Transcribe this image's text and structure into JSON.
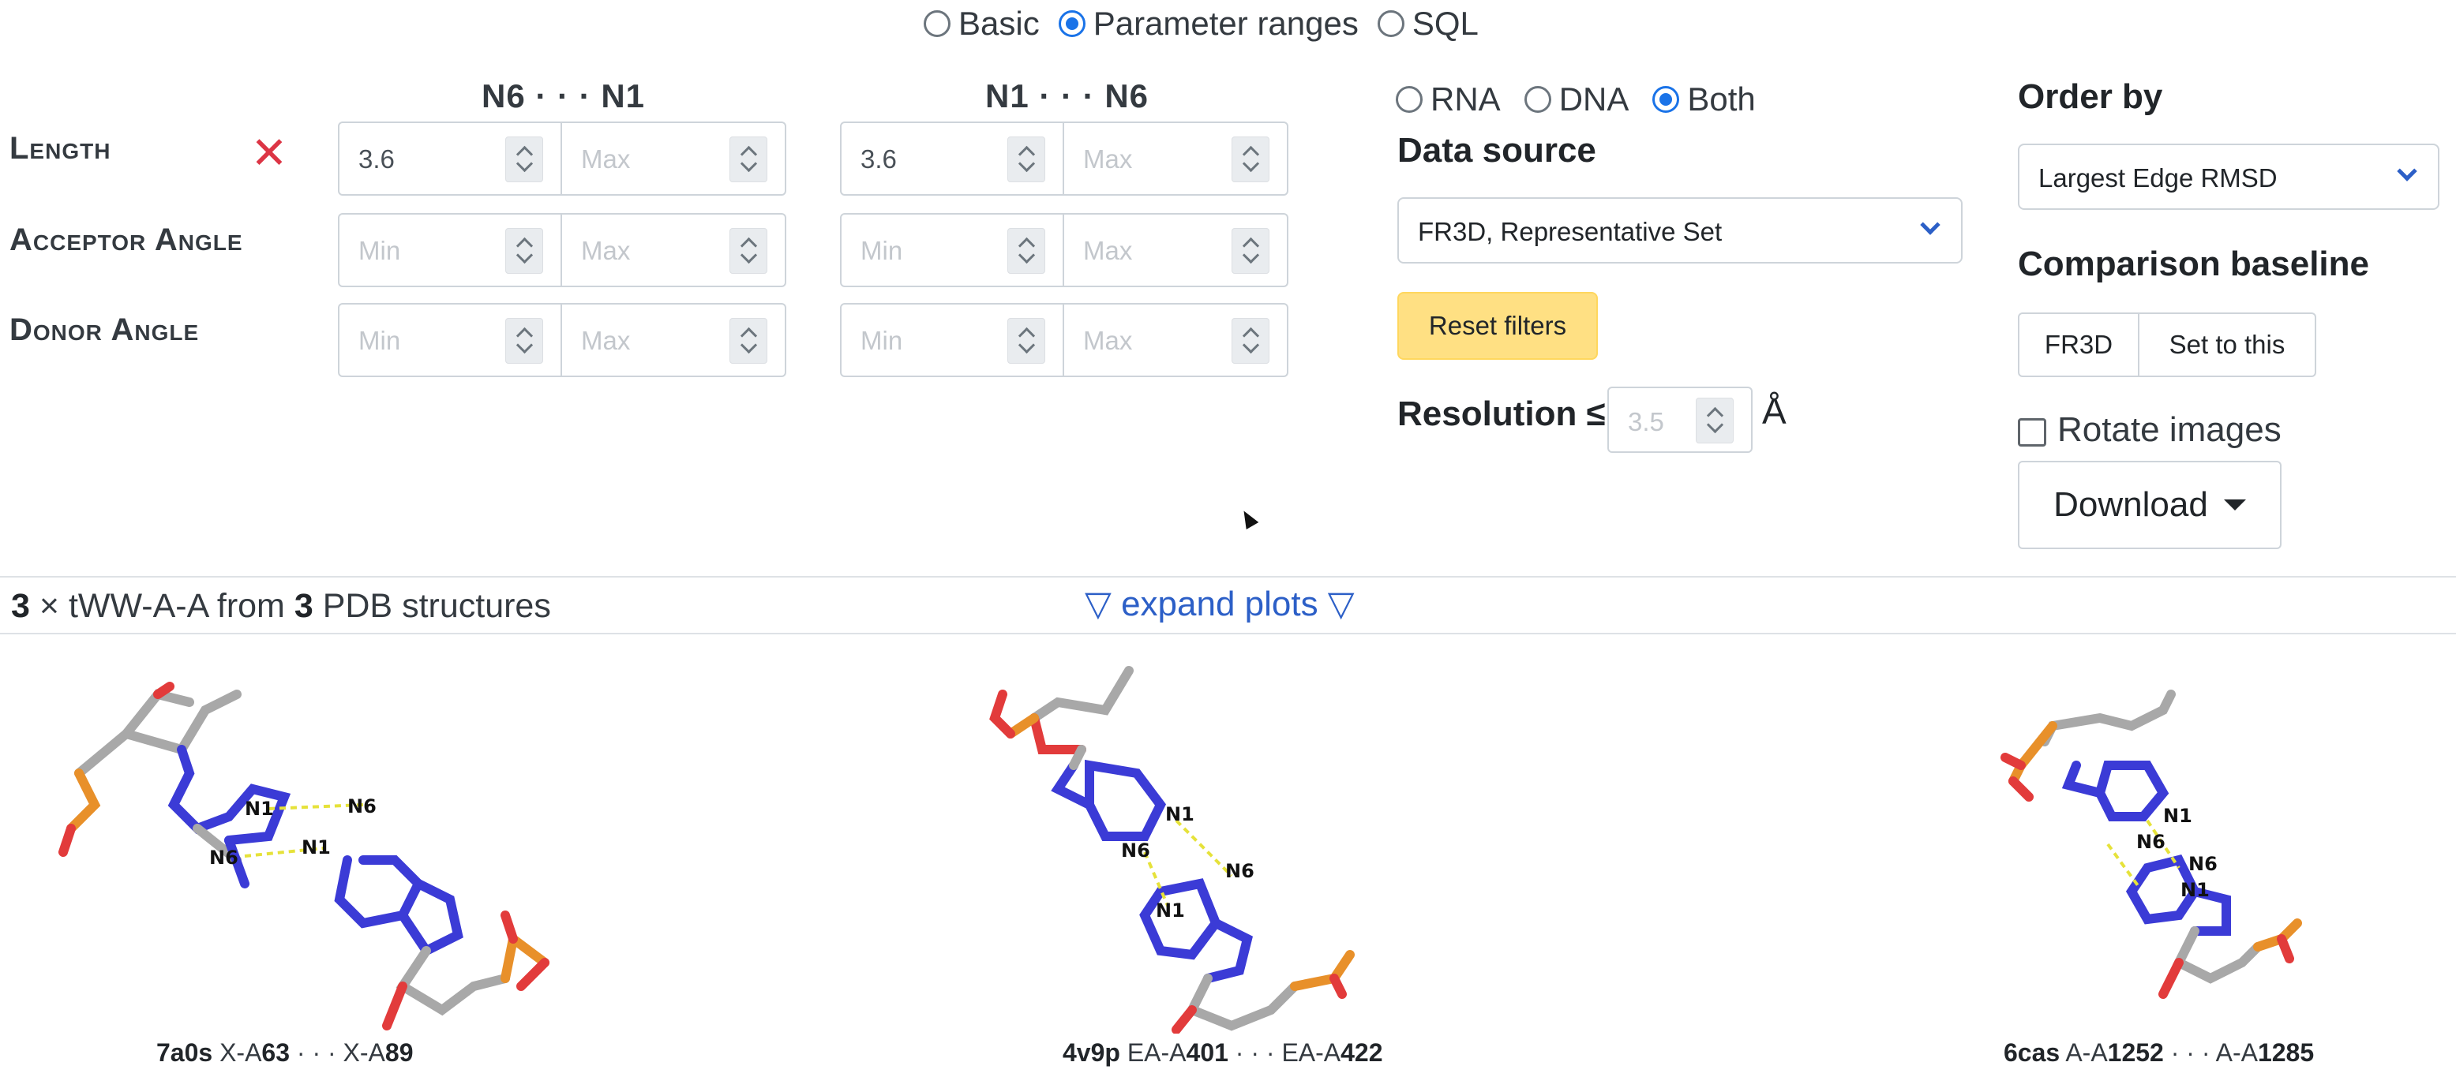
{
  "mode": {
    "options": [
      "Basic",
      "Parameter ranges",
      "SQL"
    ],
    "selected": "Parameter ranges"
  },
  "params": {
    "col1_header": "N6 · · · N1",
    "col2_header": "N1 · · · N6",
    "rows": [
      {
        "label": "Length",
        "col1": {
          "min": "3.6",
          "max": "Max"
        },
        "col2": {
          "min": "3.6",
          "max": "Max"
        }
      },
      {
        "label": "Acceptor Angle",
        "col1": {
          "min": "Min",
          "max": "Max"
        },
        "col2": {
          "min": "Min",
          "max": "Max"
        }
      },
      {
        "label": "Donor Angle",
        "col1": {
          "min": "Min",
          "max": "Max"
        },
        "col2": {
          "min": "Min",
          "max": "Max"
        }
      }
    ],
    "clear_icon": "x-icon"
  },
  "na_type": {
    "options": [
      "RNA",
      "DNA",
      "Both"
    ],
    "selected": "Both"
  },
  "data_source": {
    "label": "Data source",
    "value": "FR3D, Representative Set"
  },
  "reset_label": "Reset filters",
  "resolution": {
    "label": "Resolution ≤",
    "placeholder": "3.5",
    "unit": "Å"
  },
  "order_by": {
    "label": "Order by",
    "value": "Largest Edge RMSD"
  },
  "comparison": {
    "label": "Comparison baseline",
    "buttons": [
      "FR3D",
      "Set to this"
    ]
  },
  "rotate_label": "Rotate images",
  "download_label": "Download",
  "summary": {
    "count": "3",
    "times": "×",
    "type": "tWW-A-A",
    "from": "from",
    "structures": "3",
    "suffix": "PDB structures"
  },
  "expand_label": "▽ expand plots ▽",
  "results": [
    {
      "pdb": "7a0s",
      "chain1": "X-A",
      "res1": "63",
      "sep": "· · ·",
      "chain2": "X-A",
      "res2": "89"
    },
    {
      "pdb": "4v9p",
      "chain1": "EA-A",
      "res1": "401",
      "sep": "· · ·",
      "chain2": "EA-A",
      "res2": "422"
    },
    {
      "pdb": "6cas",
      "chain1": "A-A",
      "res1": "1252",
      "sep": "· · ·",
      "chain2": "A-A",
      "res2": "1285"
    }
  ],
  "atom_labels": {
    "n1": "N1",
    "n6": "N6"
  },
  "colors": {
    "accent": "#1a73e8",
    "link": "#2c5fc7",
    "reset_bg": "#ffe083",
    "clear_red": "#dc3545",
    "nitrogen": "#3b3bd6",
    "oxygen": "#e23b3b",
    "phosphorus": "#e8902a",
    "carbon": "#a8a8a8",
    "hbond": "#e6e23a"
  }
}
